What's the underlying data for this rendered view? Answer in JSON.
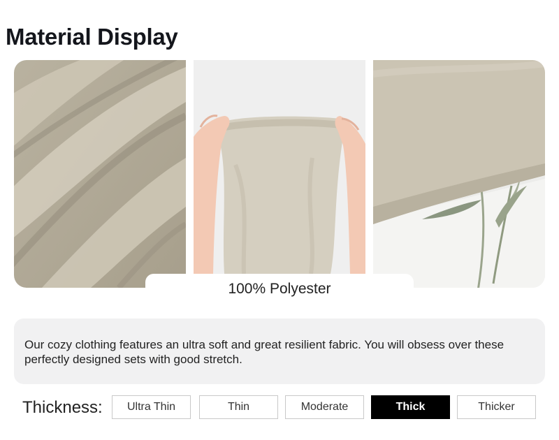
{
  "page": {
    "title": "Material Display"
  },
  "material": {
    "caption": "100% Polyester"
  },
  "description": {
    "text": "Our cozy clothing features an ultra soft and great resilient fabric. You will obsess over these perfectly designed sets with good stretch."
  },
  "thickness": {
    "label": "Thickness:",
    "options": [
      "Ultra Thin",
      "Thin",
      "Moderate",
      "Thick",
      "Thicker"
    ],
    "selected": "Thick"
  },
  "colors": {
    "fabric": "#c8c1b0",
    "selected_bg": "#000000",
    "description_bg": "#f1f1f2"
  }
}
